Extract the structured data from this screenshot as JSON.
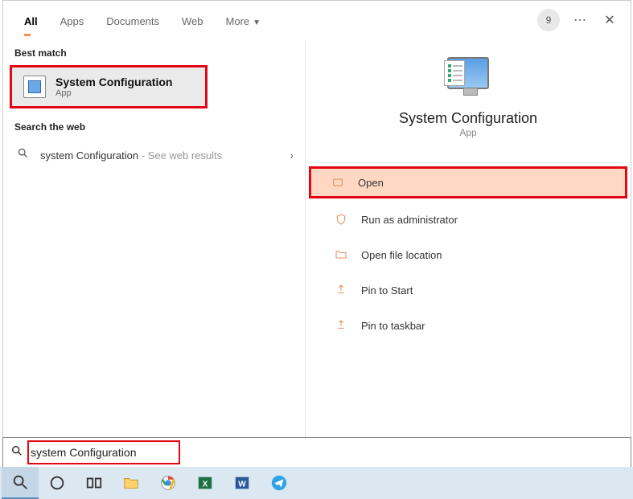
{
  "tabs": {
    "all": "All",
    "apps": "Apps",
    "documents": "Documents",
    "web": "Web",
    "more": "More"
  },
  "badge_count": "9",
  "sections": {
    "best_match": "Best match",
    "search_web": "Search the web"
  },
  "best_match": {
    "title": "System Configuration",
    "subtitle": "App"
  },
  "web_result": {
    "prefix": "system Configuration",
    "suffix": " - See web results"
  },
  "detail": {
    "title": "System Configuration",
    "subtitle": "App"
  },
  "actions": {
    "open": "Open",
    "run_admin": "Run as administrator",
    "open_file_location": "Open file location",
    "pin_start": "Pin to Start",
    "pin_taskbar": "Pin to taskbar"
  },
  "search_value": "system Configuration",
  "colors": {
    "accent": "#ff8c4a",
    "highlight_bg": "#ffd8c4",
    "annotation": "#e30613"
  }
}
